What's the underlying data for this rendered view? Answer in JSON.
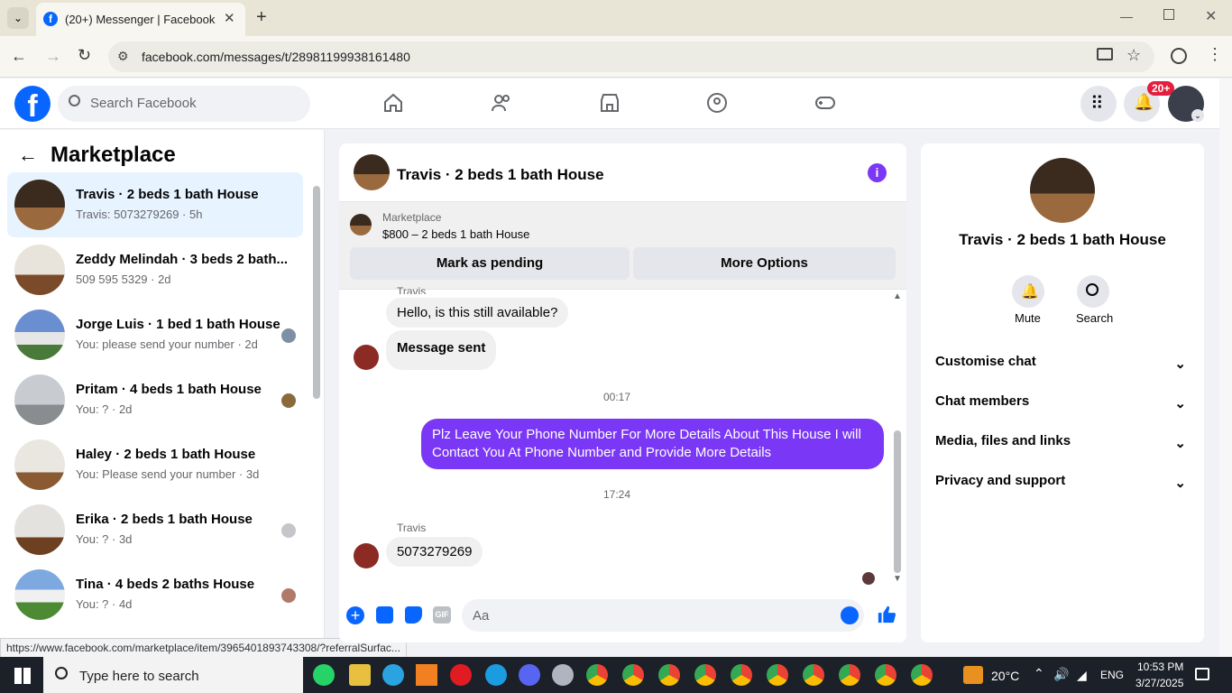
{
  "browser": {
    "tab_title": "(20+) Messenger | Facebook",
    "url": "facebook.com/messages/t/28981199938161480",
    "status_url": "https://www.facebook.com/marketplace/item/3965401893743308/?referralSurfac..."
  },
  "header": {
    "search_placeholder": "Search Facebook",
    "notif_badge": "20+"
  },
  "sidebar": {
    "title": "Marketplace",
    "conversations": [
      {
        "title": "Travis · 2 beds 1 bath House",
        "subtitle": "Travis: 5073279269 · 5h"
      },
      {
        "title": "Zeddy Melindah · 3 beds 2 bath...",
        "subtitle": "509 595 5329 · 2d"
      },
      {
        "title": "Jorge Luis · 1 bed 1 bath House",
        "subtitle": "You: please send your number · 2d"
      },
      {
        "title": "Pritam · 4 beds 1 bath House",
        "subtitle": "You: ? · 2d"
      },
      {
        "title": "Haley · 2 beds 1 bath House",
        "subtitle": "You: Please send your number · 3d"
      },
      {
        "title": "Erika · 2 beds 1 bath House",
        "subtitle": "You: ? · 3d"
      },
      {
        "title": "Tina · 4 beds 2 baths House",
        "subtitle": "You: ? · 4d"
      }
    ]
  },
  "chat": {
    "title": "Travis · 2 beds 1 bath House",
    "listing_label": "Marketplace",
    "listing_price": "$800 – 2 beds 1 bath House",
    "mark_pending": "Mark as pending",
    "more_options": "More Options",
    "sender_top": "Travis",
    "msg1": "Hello, is this still available?",
    "msg2": "Message sent",
    "time1": "00:17",
    "msg3": "Plz Leave Your Phone Number For More Details About This House I will Contact You At Phone Number and Provide More Details",
    "time2": "17:24",
    "sender2": "Travis",
    "msg4": "5073279269",
    "composer_placeholder": "Aa"
  },
  "info": {
    "title": "Travis · 2 beds 1 bath House",
    "mute": "Mute",
    "search": "Search",
    "rows": [
      "Customise chat",
      "Chat members",
      "Media, files and links",
      "Privacy and support"
    ]
  },
  "taskbar": {
    "search_placeholder": "Type here to search",
    "temperature": "20°C",
    "lang": "ENG",
    "time": "10:53 PM",
    "date": "3/27/2025"
  },
  "colors": {
    "accent": "#0866ff",
    "messenger_purple": "#7a37f5",
    "badge_red": "#e41e3f"
  }
}
